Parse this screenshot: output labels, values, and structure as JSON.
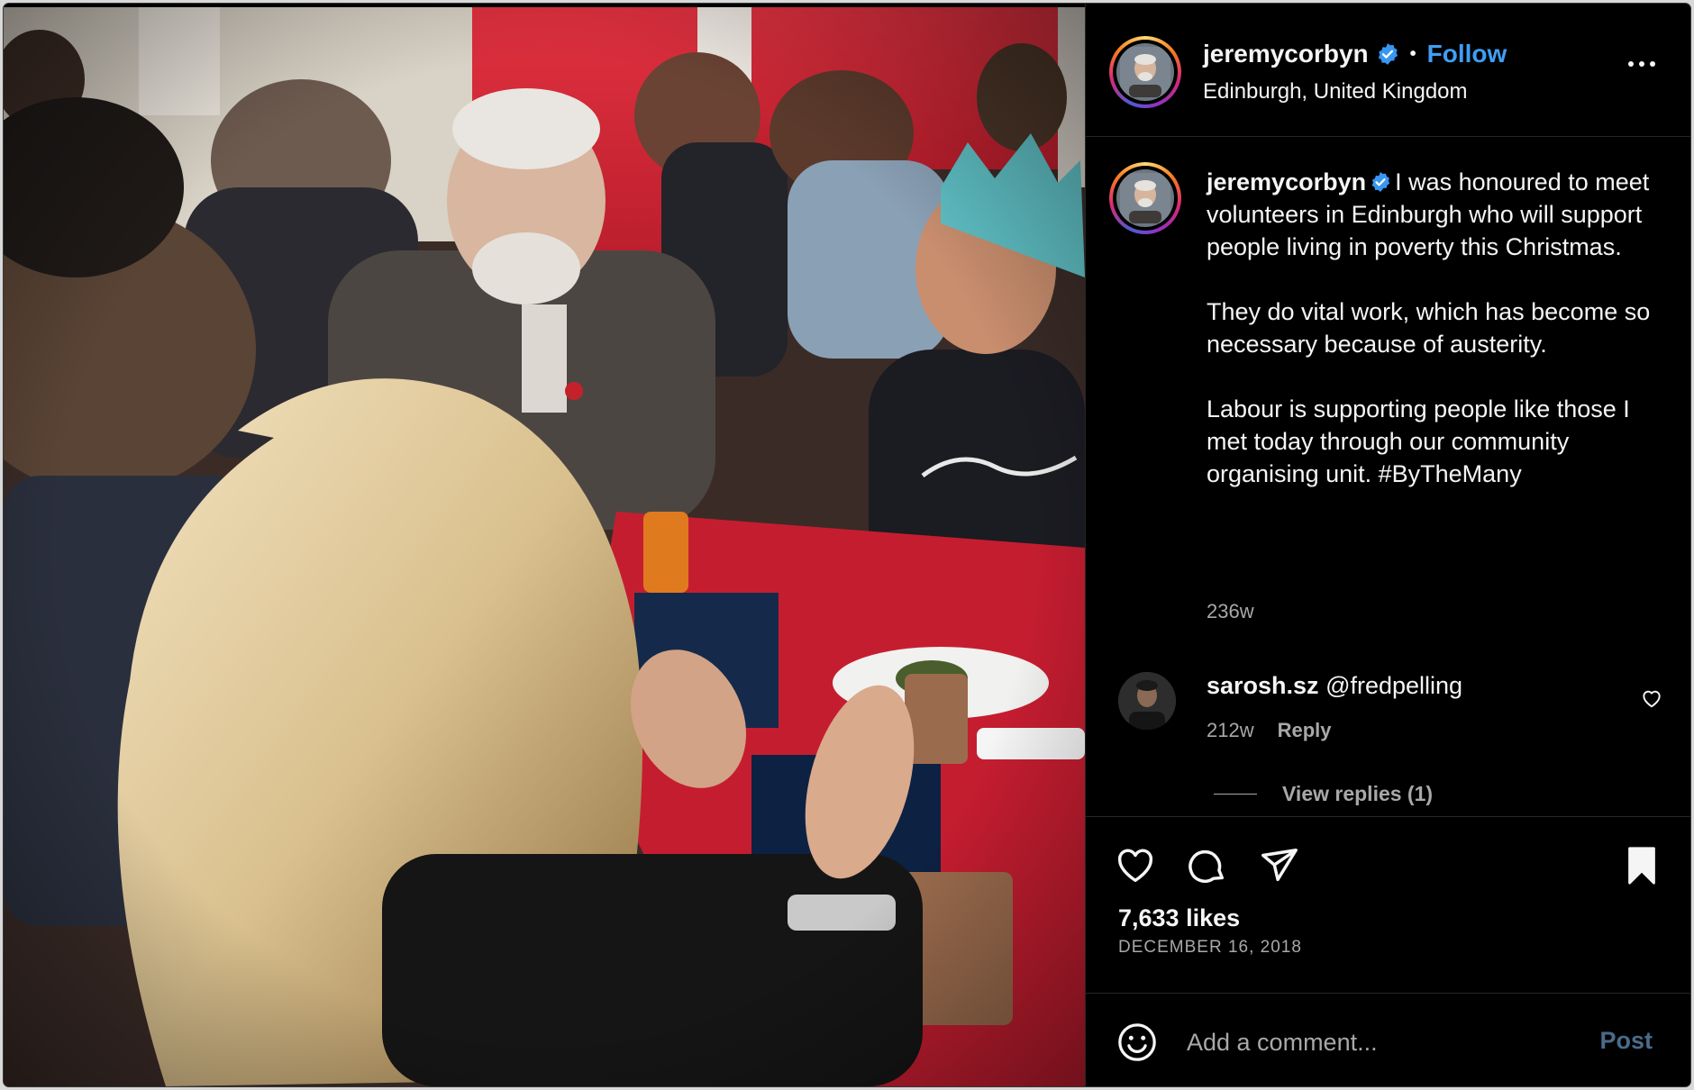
{
  "post": {
    "username": "jeremycorbyn",
    "follow_label": "Follow",
    "dot": "•",
    "location": "Edinburgh, United Kingdom",
    "caption_lines": [
      "I was honoured to meet volunteers in Edinburgh who will support people living in poverty this Christmas.",
      "They do vital work, which has become so necessary because of austerity.",
      "Labour is supporting people like those I met today through our community organising unit. #ByTheMany"
    ],
    "caption_time": "236w",
    "likes": "7,633 likes",
    "date": "DECEMBER 16, 2018"
  },
  "comment": {
    "username": "sarosh.sz",
    "text": "@fredpelling",
    "time": "212w",
    "reply_label": "Reply",
    "view_replies": "View replies (1)"
  },
  "composer": {
    "placeholder": "Add a comment...",
    "post_label": "Post"
  },
  "colors": {
    "background": "#000000",
    "text": "#f5f5f5",
    "muted": "#a8a8a8",
    "accent": "#3f9ef5",
    "verified": "#3897f0"
  },
  "icons": {
    "more": "more-horizontal-icon",
    "verified": "verified-badge-icon",
    "like": "heart-icon",
    "comment": "comment-bubble-icon",
    "share": "paper-plane-icon",
    "save": "bookmark-filled-icon",
    "emoji": "smiley-icon"
  }
}
